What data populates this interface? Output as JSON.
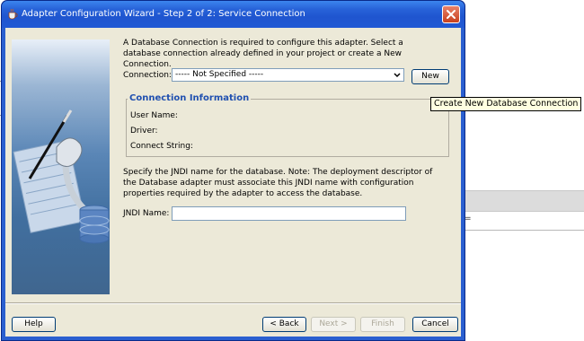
{
  "window": {
    "title": "Adapter Configuration Wizard - Step 2 of 2: Service Connection",
    "close_icon": "close-icon"
  },
  "main": {
    "intro_text": "A Database Connection is required to configure this adapter. Select a database connection already defined in your project or create a New Connection.",
    "connection_label": "Connection:",
    "connection_value": "----- Not Specified -----",
    "new_button": "New",
    "connection_info": {
      "title": "Connection Information",
      "user_name_label": "User Name:",
      "driver_label": "Driver:",
      "connect_string_label": "Connect String:"
    },
    "jndi_text": "Specify the JNDI name for the database.  Note: The deployment descriptor of the Database adapter must associate this JNDI name with configuration properties required by the adapter to access the database.",
    "jndi_label": "JNDI Name:",
    "jndi_value": ""
  },
  "footer": {
    "help": "Help",
    "back": "< Back",
    "next": "Next >",
    "finish": "Finish",
    "cancel": "Cancel"
  },
  "tooltip": "Create New Database Connection",
  "background": {
    "glyph": "="
  },
  "colors": {
    "title_bar": "#2863d9",
    "client_bg": "#ece9d8",
    "group_title": "#2050b0",
    "tooltip_bg": "#ffffe1",
    "close_button": "#c8401e"
  }
}
